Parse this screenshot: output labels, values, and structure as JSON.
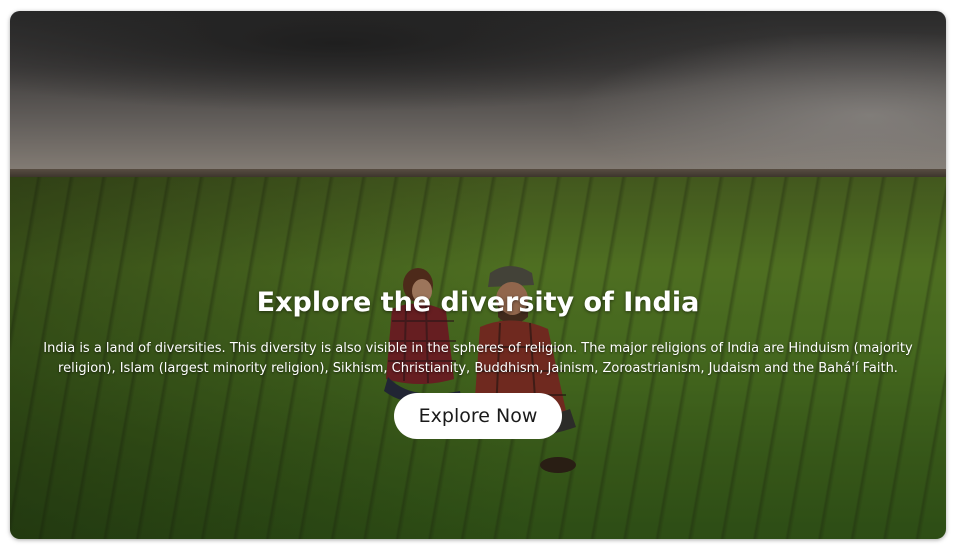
{
  "hero": {
    "title": "Explore the diversity of India",
    "description": "India is a land of diversities. This diversity is also visible in the spheres of religion. The major religions of India are Hinduism (majority religion), Islam (largest minority religion), Sikhism, Christianity, Buddhism, Jainism, Zoroastrianism, Judaism and the Bahá'í Faith.",
    "button_label": "Explore Now",
    "background_image": "farmers-in-wheat-field-photo"
  }
}
